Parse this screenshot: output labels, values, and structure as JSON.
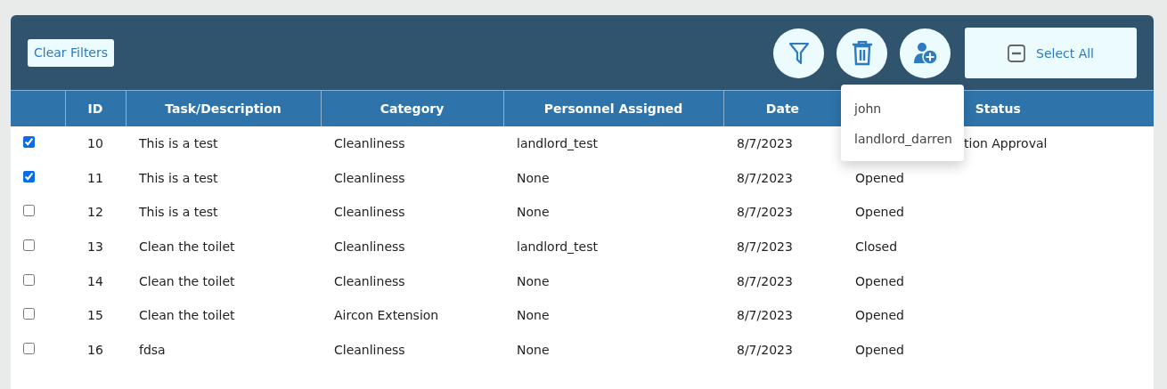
{
  "toolbar": {
    "clear_filters": "Clear Filters",
    "icon_buttons": [
      {
        "kind": "filter"
      },
      {
        "kind": "delete"
      },
      {
        "kind": "assign"
      }
    ],
    "select_all": "Select All"
  },
  "dropdown": {
    "items": [
      "john",
      "landlord_darren"
    ]
  },
  "table": {
    "columns": [
      "ID",
      "Task/Description",
      "Category",
      "Personnel Assigned",
      "Date",
      "Status"
    ],
    "rows": [
      {
        "checked": true,
        "id": "10",
        "task": "This is a test",
        "category": "Cleanliness",
        "personnel": "landlord_test",
        "date": "8/7/2023",
        "status": "tion Approval",
        "status_covered": true
      },
      {
        "checked": true,
        "id": "11",
        "task": "This is a test",
        "category": "Cleanliness",
        "personnel": "None",
        "date": "8/7/2023",
        "status": "Opened",
        "status_covered": false
      },
      {
        "checked": false,
        "id": "12",
        "task": "This is a test",
        "category": "Cleanliness",
        "personnel": "None",
        "date": "8/7/2023",
        "status": "Opened",
        "status_covered": false
      },
      {
        "checked": false,
        "id": "13",
        "task": "Clean the toilet",
        "category": "Cleanliness",
        "personnel": "landlord_test",
        "date": "8/7/2023",
        "status": "Closed",
        "status_covered": false
      },
      {
        "checked": false,
        "id": "14",
        "task": "Clean the toilet",
        "category": "Cleanliness",
        "personnel": "None",
        "date": "8/7/2023",
        "status": "Opened",
        "status_covered": false
      },
      {
        "checked": false,
        "id": "15",
        "task": "Clean the toilet",
        "category": "Aircon Extension",
        "personnel": "None",
        "date": "8/7/2023",
        "status": "Opened",
        "status_covered": false
      },
      {
        "checked": false,
        "id": "16",
        "task": "fdsa",
        "category": "Cleanliness",
        "personnel": "None",
        "date": "8/7/2023",
        "status": "Opened",
        "status_covered": false
      }
    ]
  }
}
